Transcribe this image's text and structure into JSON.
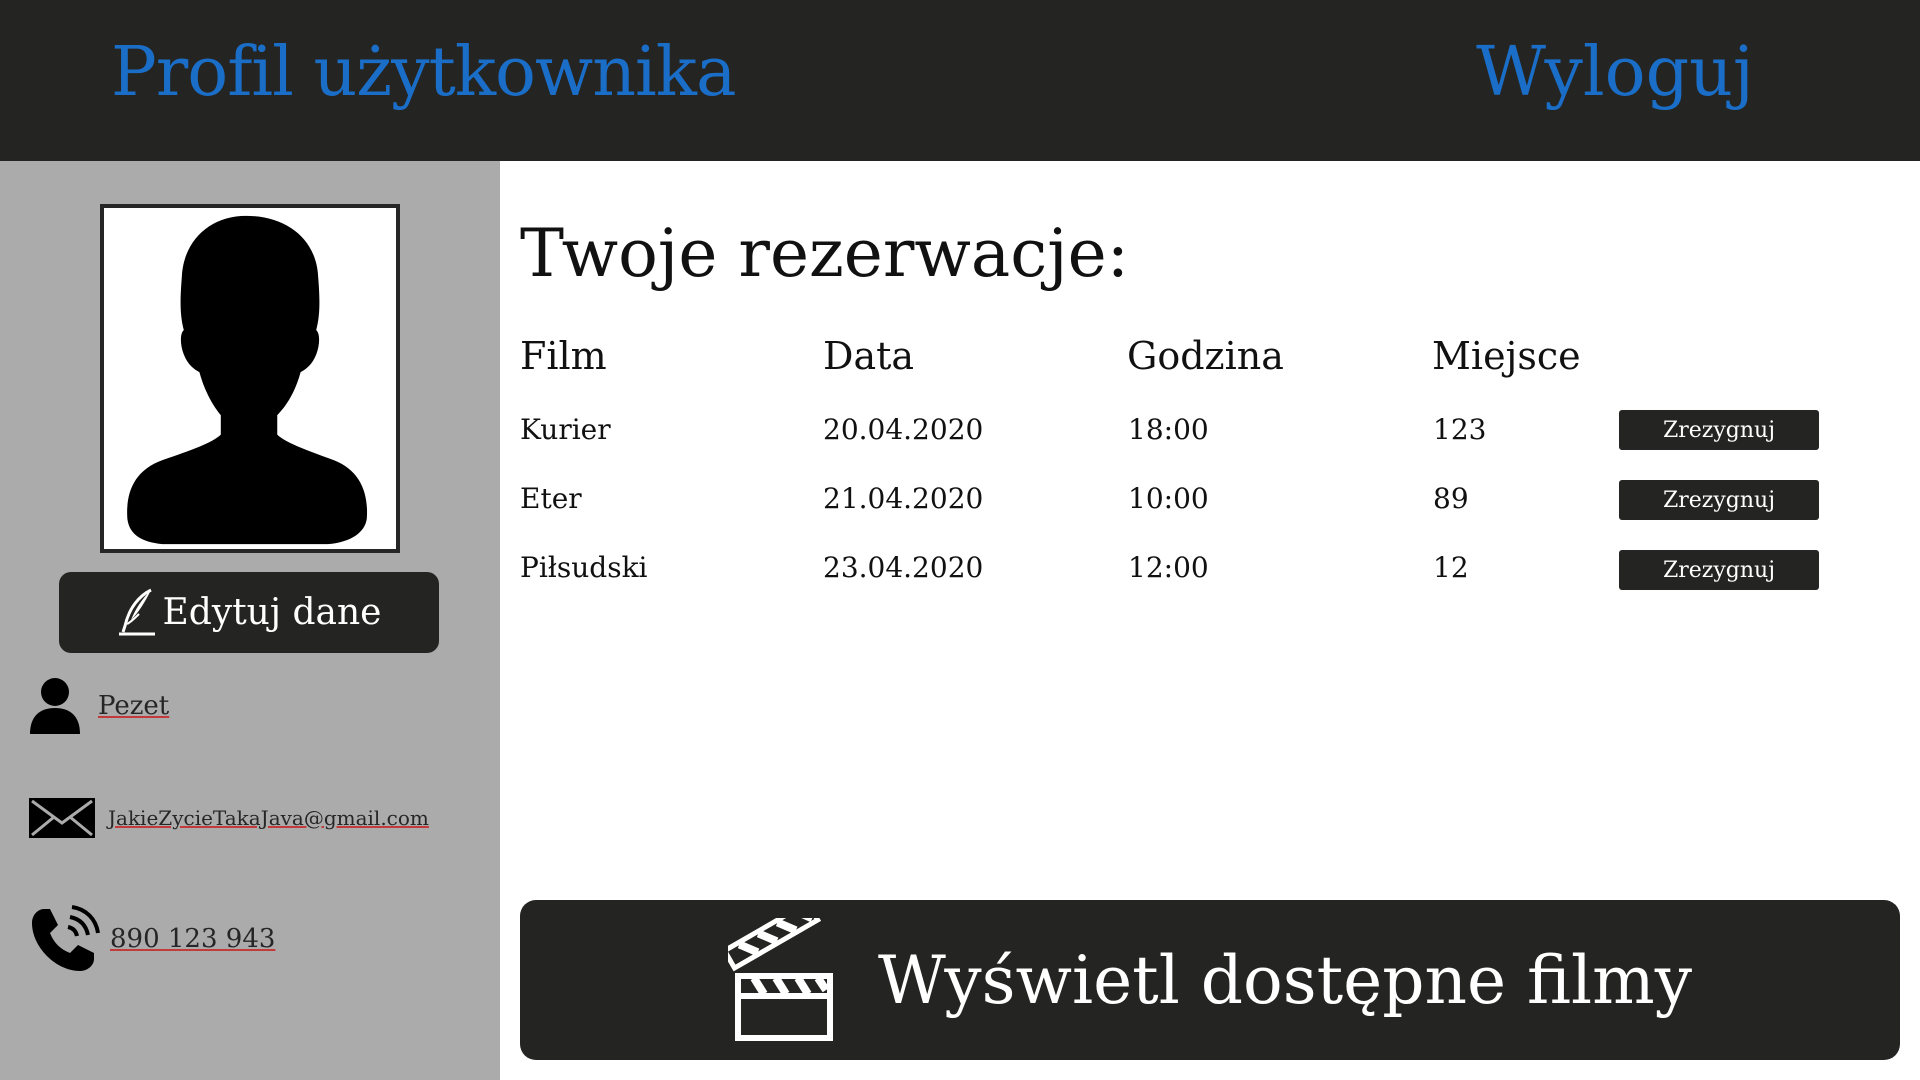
{
  "header": {
    "title": "Profil użytkownika",
    "logout_label": "Wyloguj"
  },
  "sidebar": {
    "edit_label": "Edytuj dane",
    "username": "Pezet",
    "email": "JakieZycieTakaJava@gmail.com",
    "phone": "890 123 943"
  },
  "reservations": {
    "heading": "Twoje rezerwacje:",
    "columns": [
      "Film",
      "Data",
      "Godzina",
      "Miejsce"
    ],
    "rows": [
      {
        "film": "Kurier",
        "date": "20.04.2020",
        "time": "18:00",
        "seat": "123",
        "action": "Zrezygnuj"
      },
      {
        "film": "Eter",
        "date": "21.04.2020",
        "time": "10:00",
        "seat": "89",
        "action": "Zrezygnuj"
      },
      {
        "film": "Piłsudski",
        "date": "23.04.2020",
        "time": "12:00",
        "seat": "12",
        "action": "Zrezygnuj"
      }
    ]
  },
  "footer_button": {
    "label": "Wyświetl dostępne filmy"
  },
  "colors": {
    "header_bg": "#242422",
    "accent_blue": "#1a6ec8",
    "sidebar_bg": "#ababab",
    "button_bg": "#242422"
  },
  "icons": {
    "avatar": "person-silhouette-icon",
    "edit": "quill-icon",
    "user": "user-icon",
    "email": "envelope-icon",
    "phone": "phone-icon",
    "films": "clapperboard-icon"
  }
}
